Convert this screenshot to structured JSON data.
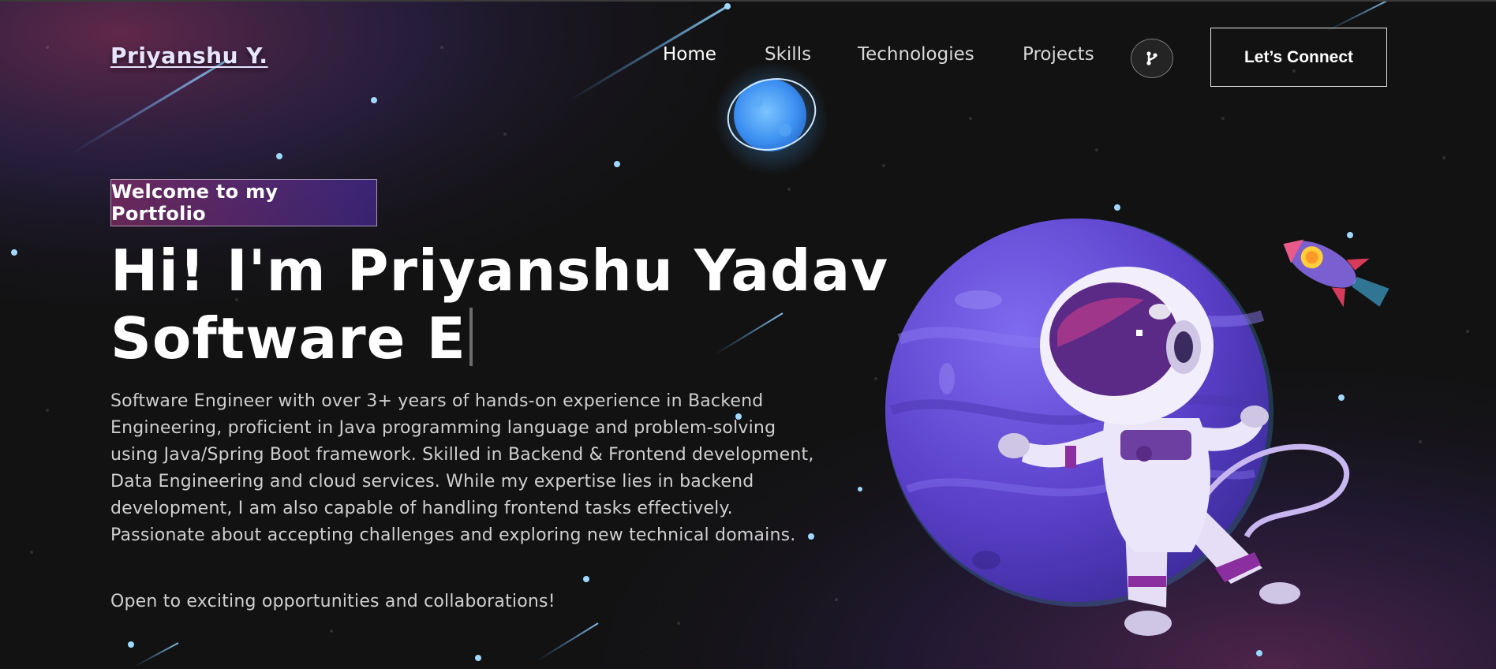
{
  "brand": {
    "logo_text": "Priyanshu Y."
  },
  "nav": {
    "items": [
      {
        "label": "Home"
      },
      {
        "label": "Skills"
      },
      {
        "label": "Technologies"
      },
      {
        "label": "Projects"
      }
    ],
    "github_icon": "git-branch-icon",
    "connect_label": "Let’s Connect"
  },
  "hero": {
    "badge": "Welcome to my Portfolio",
    "headline_line1": "Hi! I'm Priyanshu Yadav",
    "headline_line2": "Software E",
    "description": "Software Engineer with over 3+ years of hands-on experience in Backend Engineering, proficient in Java programming language and problem-solving using Java/Spring Boot framework. Skilled in Backend & Frontend development, Data Engineering and cloud services. While my expertise lies in backend development, I am also capable of handling frontend tasks effectively. Passionate about accepting challenges and exploring new technical domains.",
    "cta_text": "Open to exciting opportunities and collaborations!"
  },
  "illustrations": {
    "planet": "purple-planet-illustration",
    "astronaut": "astronaut-illustration",
    "rocket": "rocket-illustration",
    "moon": "glowing-blue-moon-illustration"
  },
  "colors": {
    "background": "#121212",
    "badge_gradient_start": "#aa367c",
    "badge_gradient_end": "#4a2fbd",
    "planet": "#6a4fd8",
    "moon_glow": "#4aa8ff"
  }
}
